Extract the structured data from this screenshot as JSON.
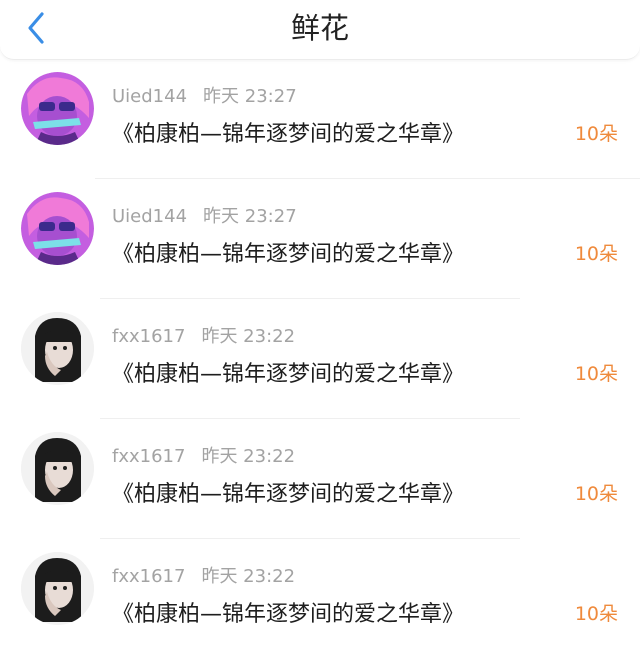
{
  "header": {
    "title": "鲜花",
    "back_icon": "chevron-left-icon",
    "accent": "#3a8ee6"
  },
  "items": [
    {
      "user": "Uied144",
      "time": "昨天 23:27",
      "message": "《柏康柏—锦年逐梦间的爱之华章》",
      "amount": "10朵",
      "avatar_style": "pink-cartoon"
    },
    {
      "user": "Uied144",
      "time": "昨天 23:27",
      "message": "《柏康柏—锦年逐梦间的爱之华章》",
      "amount": "10朵",
      "avatar_style": "pink-cartoon"
    },
    {
      "user": "fxx1617",
      "time": "昨天 23:22",
      "message": "《柏康柏—锦年逐梦间的爱之华章》",
      "amount": "10朵",
      "avatar_style": "dark-hair-portrait"
    },
    {
      "user": "fxx1617",
      "time": "昨天 23:22",
      "message": "《柏康柏—锦年逐梦间的爱之华章》",
      "amount": "10朵",
      "avatar_style": "dark-hair-portrait"
    },
    {
      "user": "fxx1617",
      "time": "昨天 23:22",
      "message": "《柏康柏—锦年逐梦间的爱之华章》",
      "amount": "10朵",
      "avatar_style": "dark-hair-portrait"
    }
  ],
  "colors": {
    "amount": "#ef8a3c",
    "meta": "#a3a3a3"
  }
}
